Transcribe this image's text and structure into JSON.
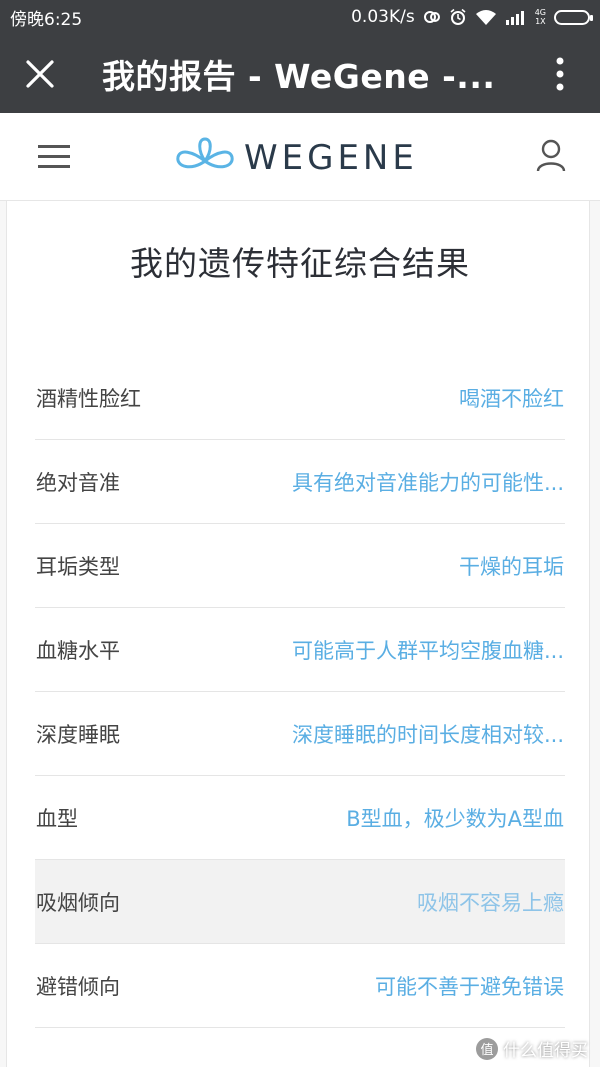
{
  "status_bar": {
    "time": "傍晚6:25",
    "network_speed": "0.03K/s",
    "network_type": "4G",
    "sim_slot": "1X"
  },
  "browser": {
    "title": "我的报告 - WeGene -..."
  },
  "header": {
    "logo_text": "WEGENE"
  },
  "page": {
    "title": "我的遗传特征综合结果"
  },
  "traits": [
    {
      "name": "酒精性脸红",
      "value": "喝酒不脸红"
    },
    {
      "name": "绝对音准",
      "value": "具有绝对音准能力的可能性..."
    },
    {
      "name": "耳垢类型",
      "value": "干燥的耳垢"
    },
    {
      "name": "血糖水平",
      "value": "可能高于人群平均空腹血糖..."
    },
    {
      "name": "深度睡眠",
      "value": "深度睡眠的时间长度相对较..."
    },
    {
      "name": "血型",
      "value": "B型血，极少数为A型血"
    },
    {
      "name": "吸烟倾向",
      "value": "吸烟不容易上瘾"
    },
    {
      "name": "避错倾向",
      "value": "可能不善于避免错误"
    }
  ],
  "watermark": {
    "badge": "值",
    "text": "什么值得买"
  },
  "colors": {
    "bar_background": "#3d3f42",
    "accent_blue": "#5aaee3",
    "logo_dark": "#2a3a4a"
  }
}
